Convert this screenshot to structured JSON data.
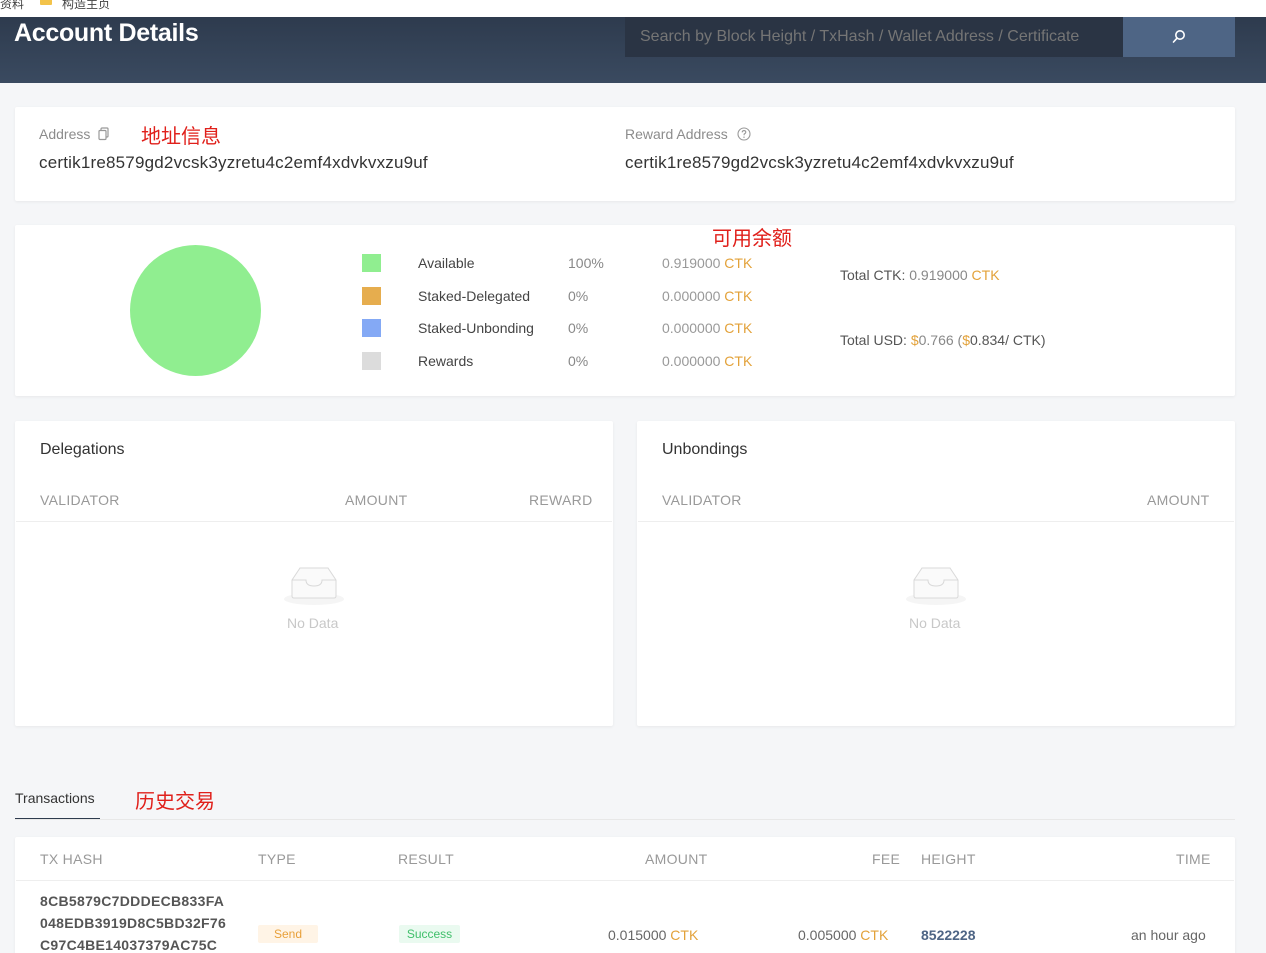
{
  "browser": {
    "bookmarks": [
      "资料",
      "构造主页"
    ]
  },
  "header": {
    "title": "Account Details",
    "search_placeholder": "Search by Block Height / TxHash / Wallet Address / Certificate",
    "search_icon": "search-icon"
  },
  "address_card": {
    "address_label": "Address",
    "address_value": "certik1re8579gd2vcsk3yzretu4c2emf4xdvkvxzu9uf",
    "reward_label": "Reward Address",
    "reward_value": "certik1re8579gd2vcsk3yzretu4c2emf4xdvkvxzu9uf",
    "annotation": "地址信息"
  },
  "balance_card": {
    "annotation": "可用余额",
    "unit": "CTK",
    "legend": [
      {
        "name": "Available",
        "pct": "100%",
        "amount": "0.919000",
        "color": "#90ee90"
      },
      {
        "name": "Staked-Delegated",
        "pct": "0%",
        "amount": "0.000000",
        "color": "#e6ad4e"
      },
      {
        "name": "Staked-Unbonding",
        "pct": "0%",
        "amount": "0.000000",
        "color": "#84a9f5"
      },
      {
        "name": "Rewards",
        "pct": "0%",
        "amount": "0.000000",
        "color": "#dcdcdc"
      }
    ],
    "total_ctk_label": "Total CTK:",
    "total_ctk_value": "0.919000",
    "total_usd_label": "Total USD:",
    "currency_symbol": "$",
    "total_usd_value": "0.766",
    "price_value": "0.834",
    "price_suffix": "/ CTK)"
  },
  "delegations": {
    "title": "Delegations",
    "columns": [
      "VALIDATOR",
      "AMOUNT",
      "REWARD"
    ],
    "empty_text": "No Data"
  },
  "unbondings": {
    "title": "Unbondings",
    "columns": [
      "VALIDATOR",
      "AMOUNT"
    ],
    "empty_text": "No Data"
  },
  "transactions": {
    "tab_label": "Transactions",
    "annotation": "历史交易",
    "columns": [
      "TX HASH",
      "TYPE",
      "RESULT",
      "AMOUNT",
      "FEE",
      "HEIGHT",
      "TIME"
    ],
    "rows": [
      {
        "hash_lines": [
          "8CB5879C7DDDECB833FA",
          "048EDB3919D8C5BD32F76",
          "C97C4BE14037379AC75C"
        ],
        "type": "Send",
        "result": "Success",
        "amount": "0.015000",
        "fee": "0.005000",
        "height": "8522228",
        "time": "an hour ago"
      }
    ]
  }
}
